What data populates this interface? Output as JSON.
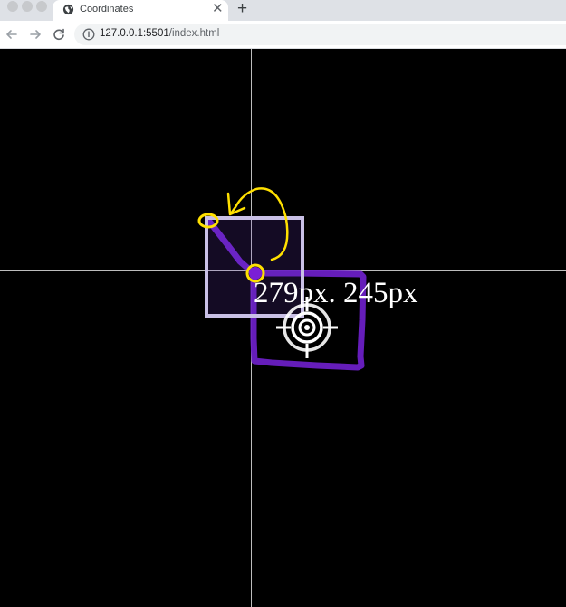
{
  "browser": {
    "tab": {
      "title": "Coordinates",
      "favicon": "globe-icon",
      "close_icon": "close-icon"
    },
    "new_tab_icon": "plus-icon",
    "toolbar": {
      "back_icon": "back-arrow-icon",
      "forward_icon": "forward-arrow-icon",
      "reload_icon": "reload-icon",
      "site_info_icon": "info-icon",
      "url_host": "127.0.0.1:5501",
      "url_path": "/index.html"
    }
  },
  "page": {
    "coordinate_readout": "279px. 245px",
    "cursor_icon": "crosshair-target-icon"
  },
  "colors": {
    "page_background": "#000000",
    "axis_lines": "#bdbdbd",
    "readout_text": "#ffffff",
    "annotation_purple": "#7a1fd6",
    "annotation_yellow": "#ffe000",
    "box_outline": "#c9c0e6"
  }
}
